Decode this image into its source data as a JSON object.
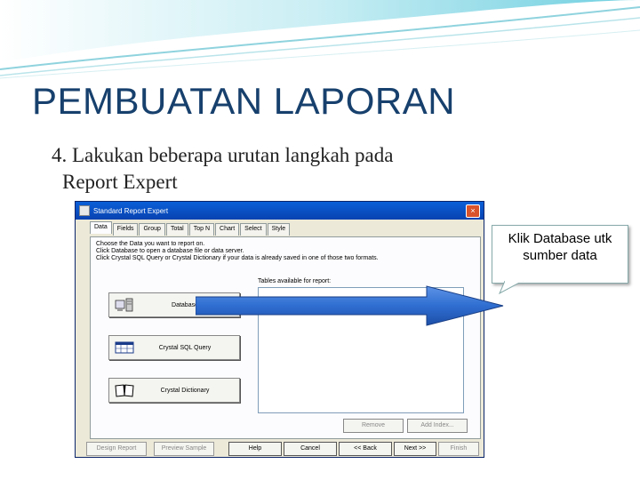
{
  "slide": {
    "title": "PEMBUATAN LAPORAN",
    "bullet_line1": "4. Lakukan beberapa urutan langkah pada",
    "bullet_line2": "Report Expert"
  },
  "dialog": {
    "title": "Standard Report Expert",
    "close_label": "×",
    "tabs": [
      "Data",
      "Fields",
      "Group",
      "Total",
      "Top N",
      "Chart",
      "Select",
      "Style"
    ],
    "instructions": [
      "Choose the Data you want to report on.",
      "Click Database to open a database file or data server.",
      "Click Crystal SQL Query or Crystal Dictionary if your data is already saved in one of those two formats."
    ],
    "source_buttons": [
      "Database",
      "Crystal SQL Query",
      "Crystal Dictionary"
    ],
    "tables_label": "Tables available for report:",
    "remove_label": "Remove",
    "add_index_label": "Add Index...",
    "footer": {
      "design": "Design Report",
      "preview": "Preview Sample",
      "help": "Help",
      "cancel": "Cancel",
      "back": "<< Back",
      "next": "Next >>",
      "finish": "Finish"
    }
  },
  "callout": {
    "line1": "Klik Database utk",
    "line2": "sumber data"
  },
  "colors": {
    "title": "#17406d",
    "arrow_fill": "#2f6ed1",
    "titlebar": "#0a5fd8"
  }
}
